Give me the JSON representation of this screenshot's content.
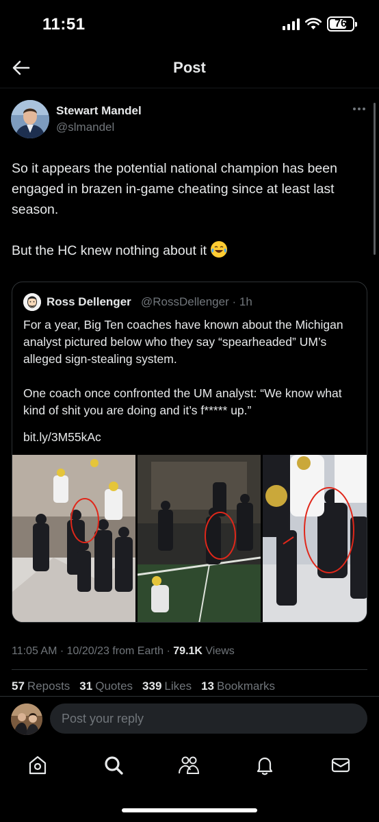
{
  "status_bar": {
    "time": "11:51",
    "battery": "76",
    "battery_level": 0.76
  },
  "header": {
    "title": "Post"
  },
  "tweet": {
    "author_name": "Stewart Mandel",
    "author_handle": "@slmandel",
    "text_part1": "So it appears the potential national champion has been engaged in brazen in-game cheating since at least last season.\n\nBut the HC knew nothing about it ",
    "emoji": "face-with-tears-of-joy"
  },
  "quote": {
    "author_name": "Ross Dellenger",
    "author_handle": "@RossDellenger · 1h",
    "text": "For a year, Big Ten coaches have known about the Michigan analyst pictured below who they say “spearheaded” UM’s alleged sign-stealing system.\n\nOne coach once confronted the UM analyst: “We know what kind of shit you are doing and it’s f***** up.”",
    "link": "bit.ly/3M55kAc"
  },
  "meta": {
    "timestamp": "11:05 AM · 10/20/23 from Earth · ",
    "views_count": "79.1K",
    "views_label": " Views"
  },
  "stats": [
    {
      "count": "57",
      "label": "Reposts"
    },
    {
      "count": "31",
      "label": "Quotes"
    },
    {
      "count": "339",
      "label": "Likes"
    },
    {
      "count": "13",
      "label": "Bookmarks"
    }
  ],
  "reply": {
    "placeholder": "Post your reply"
  },
  "nav": [
    "home-icon",
    "search-icon",
    "communities-icon",
    "notifications-icon",
    "messages-icon"
  ],
  "colors": {
    "background": "#000000",
    "text": "#e7e9ea",
    "secondary": "#71767b",
    "border": "#2f3336",
    "highlight_circle": "#e0271a"
  }
}
